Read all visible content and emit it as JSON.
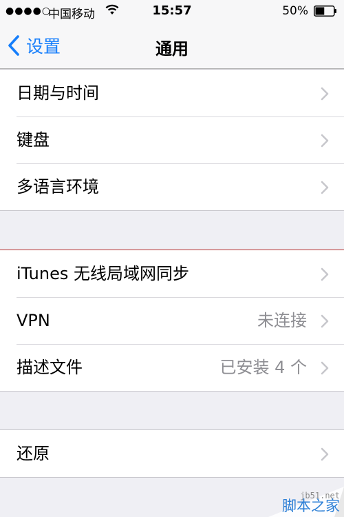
{
  "status_bar": {
    "signal": "●●●●○",
    "carrier": "中国移动",
    "wifi_icon": "wifi-icon",
    "time": "15:57",
    "battery_percent": "50%",
    "battery_icon": "battery-icon",
    "battery_level": 0.5
  },
  "nav": {
    "back_label": "设置",
    "back_icon": "chevron-left-icon",
    "title": "通用"
  },
  "groups": [
    {
      "items": [
        {
          "label": "日期与时间",
          "value": ""
        },
        {
          "label": "键盘",
          "value": ""
        },
        {
          "label": "多语言环境",
          "value": ""
        }
      ]
    },
    {
      "items": [
        {
          "label": "iTunes 无线局域网同步",
          "value": ""
        },
        {
          "label": "VPN",
          "value": "未连接"
        },
        {
          "label": "描述文件",
          "value": "已安装 4 个"
        }
      ]
    },
    {
      "items": [
        {
          "label": "还原",
          "value": ""
        }
      ]
    }
  ],
  "chevron_icon": "chevron-right-icon",
  "watermark": {
    "site": "jb51.net",
    "name": "脚本之家"
  },
  "colors": {
    "accent": "#157efb",
    "background": "#efeff4",
    "secondary_text": "#8e8e93",
    "chevron": "#c7c7cc"
  }
}
